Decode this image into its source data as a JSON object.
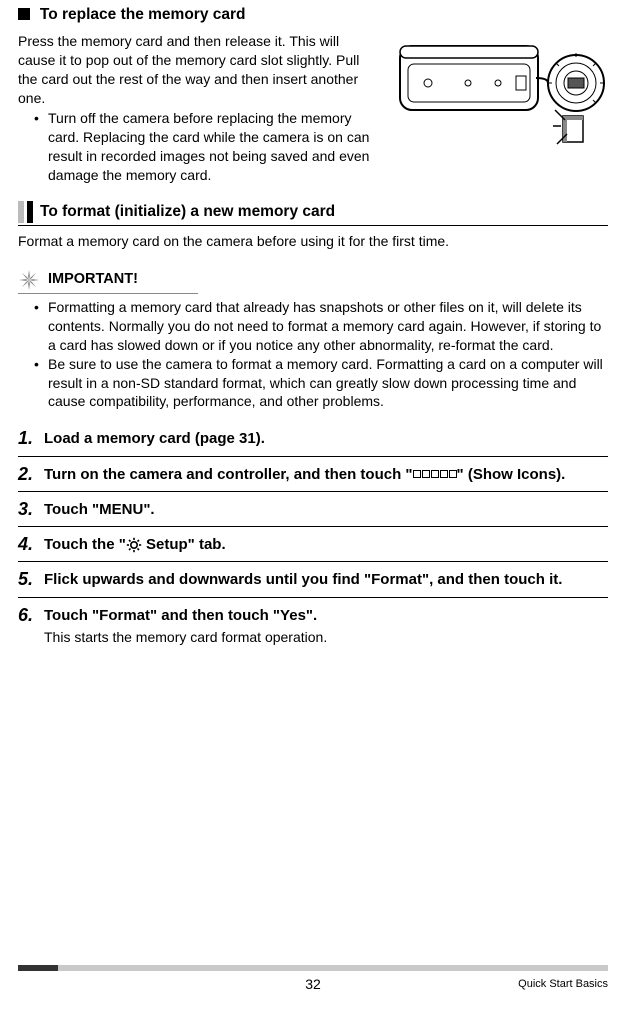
{
  "section1": {
    "heading": "To replace the memory card",
    "intro": "Press the memory card and then release it. This will cause it to pop out of the memory card slot slightly. Pull the card out the rest of the way and then insert another one.",
    "bullet": "Turn off the camera before replacing the memory card. Replacing the card while the camera is on can result in recorded images not being saved and even damage the memory card."
  },
  "section2": {
    "title": "To format (initialize) a new memory card",
    "intro": "Format a memory card on the camera before using it for the first time."
  },
  "important": {
    "label": "IMPORTANT!",
    "b1": "Formatting a memory card that already has snapshots or other files on it, will delete its contents. Normally you do not need to format a memory card again. However, if storing to a card has slowed down or if you notice any other abnormality, re-format the card.",
    "b2": "Be sure to use the camera to format a memory card. Formatting a card on a computer will result in a non-SD standard format, which can greatly slow down processing time and cause compatibility, performance, and other problems."
  },
  "steps": {
    "s1": "Load a memory card (page 31).",
    "s2a": "Turn on the camera and controller, and then touch \"",
    "s2b": "\" (Show Icons).",
    "s3": "Touch \"MENU\".",
    "s4a": "Touch the \"",
    "s4b": " Setup\" tab.",
    "s5": "Flick upwards and downwards until you find \"Format\", and then touch it.",
    "s6t": "Touch \"Format\" and then touch \"Yes\".",
    "s6n": "This starts the memory card format operation."
  },
  "footer": {
    "page": "32",
    "right": "Quick Start Basics"
  }
}
